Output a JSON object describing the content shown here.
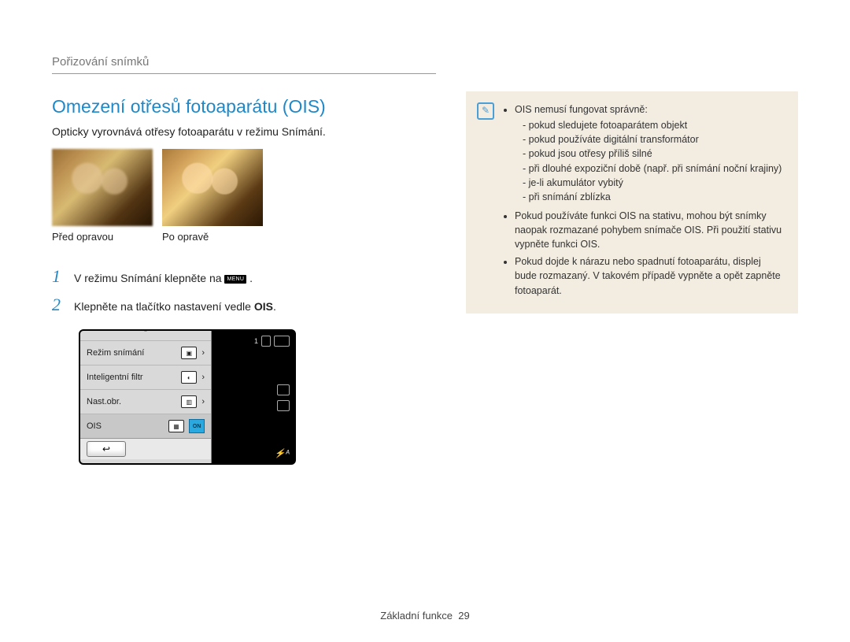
{
  "breadcrumb": "Pořizování snímků",
  "title": "Omezení otřesů fotoaparátu (OIS)",
  "subtitle": "Opticky vyrovnává otřesy fotoaparátu v režimu Snímání.",
  "photo_labels": {
    "before": "Před opravou",
    "after": "Po opravě"
  },
  "steps": {
    "s1": {
      "num": "1",
      "before": "V režimu Snímání klepněte na ",
      "menu_chip": "MENU",
      "after": " ."
    },
    "s2": {
      "num": "2",
      "before": "Klepněte na tlačítko nastavení vedle ",
      "bold": "OIS",
      "after": "."
    }
  },
  "ui": {
    "rows": {
      "r1": "Režim snímání",
      "r2": "Inteligentní filtr",
      "r3": "Nast.obr.",
      "r4": "OIS"
    },
    "on_label": "ON",
    "back": "↩",
    "counter": "1"
  },
  "note": {
    "lead": "OIS nemusí fungovat správně:",
    "sub": [
      "pokud sledujete fotoaparátem objekt",
      "pokud používáte digitální transformátor",
      "pokud jsou otřesy příliš silné",
      "při dlouhé expoziční době (např. při snímání noční krajiny)",
      "je-li akumulátor vybitý",
      "při snímání zblízka"
    ],
    "b2": "Pokud používáte funkci OIS na stativu, mohou být snímky naopak rozmazané pohybem snímače OIS. Při použití stativu vypněte funkci OIS.",
    "b3": "Pokud dojde k nárazu nebo spadnutí fotoaparátu, displej bude rozmazaný. V takovém případě vypněte a opět zapněte fotoaparát."
  },
  "footer": {
    "label": "Základní funkce",
    "page": "29"
  }
}
